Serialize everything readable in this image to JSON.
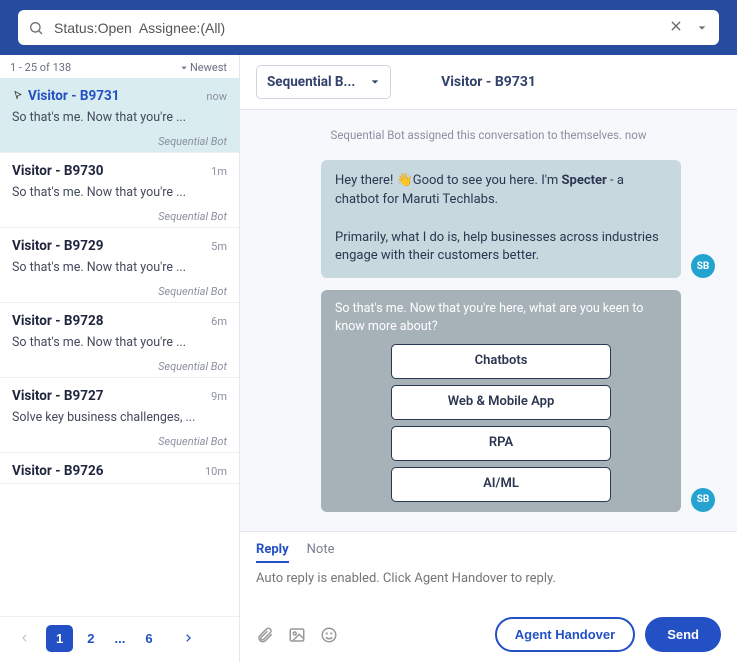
{
  "search": {
    "value": "Status:Open  Assignee:(All)"
  },
  "list": {
    "range": "1 - 25 of 138",
    "sort_label": "Newest"
  },
  "conversations": [
    {
      "name": "Visitor - B9731",
      "time": "now",
      "preview": "So that's me. Now that you're ...",
      "assignee": "Sequential Bot",
      "active": true,
      "cursor": true
    },
    {
      "name": "Visitor - B9730",
      "time": "1m",
      "preview": "So that's me. Now that you're ...",
      "assignee": "Sequential Bot"
    },
    {
      "name": "Visitor - B9729",
      "time": "5m",
      "preview": "So that's me. Now that you're ...",
      "assignee": "Sequential Bot"
    },
    {
      "name": "Visitor - B9728",
      "time": "6m",
      "preview": "So that's me. Now that you're ...",
      "assignee": "Sequential Bot"
    },
    {
      "name": "Visitor - B9727",
      "time": "9m",
      "preview": "Solve key business challenges, ...",
      "assignee": "Sequential Bot"
    },
    {
      "name": "Visitor - B9726",
      "time": "10m",
      "preview": "",
      "assignee": ""
    }
  ],
  "pager": {
    "pages": [
      "1",
      "2",
      "...",
      "6"
    ]
  },
  "conversation_header": {
    "assignee_select": "Sequential B...",
    "title": "Visitor - B9731"
  },
  "system_line": "Sequential Bot assigned this conversation to themselves. now",
  "messages": {
    "intro": {
      "prefix": "Hey there! ",
      "emoji": "👋",
      "middle": "Good to see you here. I'm ",
      "bot_name": "Specter",
      "suffix": " - a chatbot for Maruti Techlabs.",
      "line2": "Primarily, what I do is, help businesses across industries engage with their customers better.",
      "avatar": "SB"
    },
    "options": {
      "prompt": "So that's me. Now that you're here, what are you keen to know more about?",
      "buttons": [
        "Chatbots",
        "Web & Mobile App",
        "RPA",
        "AI/ML"
      ],
      "avatar": "SB"
    }
  },
  "reply": {
    "tabs": {
      "reply": "Reply",
      "note": "Note"
    },
    "placeholder": "Auto reply is enabled. Click Agent Handover to reply.",
    "handover_label": "Agent Handover",
    "send_label": "Send"
  }
}
